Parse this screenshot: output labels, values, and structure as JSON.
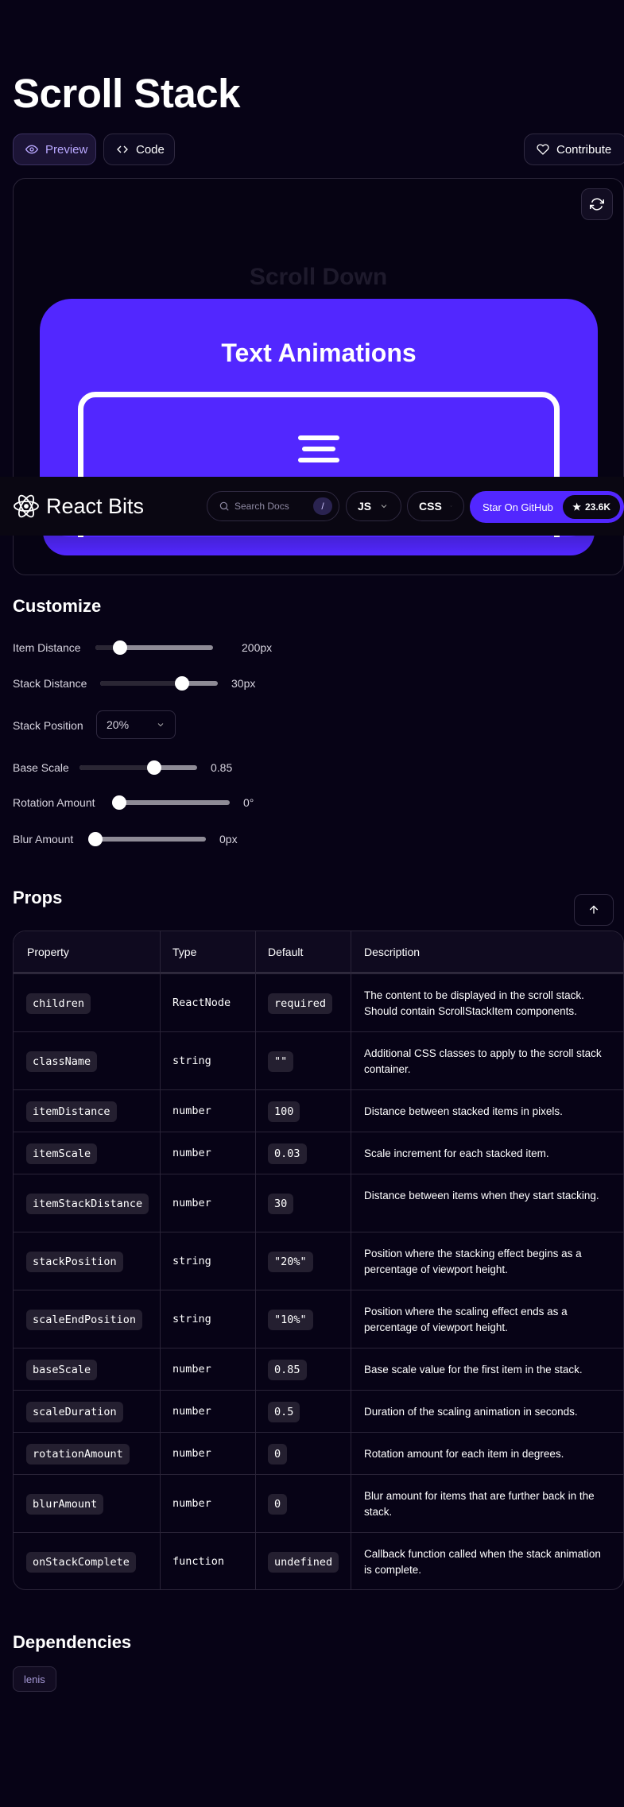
{
  "page": {
    "title": "Scroll Stack"
  },
  "tabs": {
    "preview": "Preview",
    "code": "Code",
    "contribute": "Contribute"
  },
  "preview": {
    "scroll_hint": "Scroll Down",
    "card_title": "Text Animations"
  },
  "navbar": {
    "logo": "React Bits",
    "search_placeholder": "Search Docs",
    "search_shortcut": "/",
    "lang": "JS",
    "style": "CSS",
    "github_label": "Star On GitHub",
    "github_stars": "23.6K"
  },
  "customize": {
    "title": "Customize",
    "item_distance": {
      "label": "Item Distance",
      "value": "200px",
      "fraction": 0.17
    },
    "stack_distance": {
      "label": "Stack Distance",
      "value": "30px",
      "fraction": 0.72
    },
    "stack_position": {
      "label": "Stack Position",
      "value": "20%"
    },
    "base_scale": {
      "label": "Base Scale",
      "value": "0.85",
      "fraction": 0.65
    },
    "rotation_amount": {
      "label": "Rotation Amount",
      "value": "0°",
      "fraction": 0
    },
    "blur_amount": {
      "label": "Blur Amount",
      "value": "0px",
      "fraction": 0
    }
  },
  "props": {
    "title": "Props",
    "headers": [
      "Property",
      "Type",
      "Default",
      "Description"
    ],
    "rows": [
      {
        "property": "children",
        "type": "ReactNode",
        "default": "required",
        "description": "The content to be displayed in the scroll stack. Should contain ScrollStackItem components."
      },
      {
        "property": "className",
        "type": "string",
        "default": "\"\"",
        "description": "Additional CSS classes to apply to the scroll stack container."
      },
      {
        "property": "itemDistance",
        "type": "number",
        "default": "100",
        "description": "Distance between stacked items in pixels."
      },
      {
        "property": "itemScale",
        "type": "number",
        "default": "0.03",
        "description": "Scale increment for each stacked item."
      },
      {
        "property": "itemStackDistance",
        "type": "number",
        "default": "30",
        "description": "Distance between items when they start stacking."
      },
      {
        "property": "stackPosition",
        "type": "string",
        "default": "\"20%\"",
        "description": "Position where the stacking effect begins as a percentage of viewport height."
      },
      {
        "property": "scaleEndPosition",
        "type": "string",
        "default": "\"10%\"",
        "description": "Position where the scaling effect ends as a percentage of viewport height."
      },
      {
        "property": "baseScale",
        "type": "number",
        "default": "0.85",
        "description": "Base scale value for the first item in the stack."
      },
      {
        "property": "scaleDuration",
        "type": "number",
        "default": "0.5",
        "description": "Duration of the scaling animation in seconds."
      },
      {
        "property": "rotationAmount",
        "type": "number",
        "default": "0",
        "description": "Rotation amount for each item in degrees."
      },
      {
        "property": "blurAmount",
        "type": "number",
        "default": "0",
        "description": "Blur amount for items that are further back in the stack."
      },
      {
        "property": "onStackComplete",
        "type": "function",
        "default": "undefined",
        "description": "Callback function called when the stack animation is complete."
      }
    ]
  },
  "dependencies": {
    "title": "Dependencies",
    "items": [
      "lenis"
    ]
  },
  "colors": {
    "accent": "#5227ff",
    "background": "#070316"
  }
}
